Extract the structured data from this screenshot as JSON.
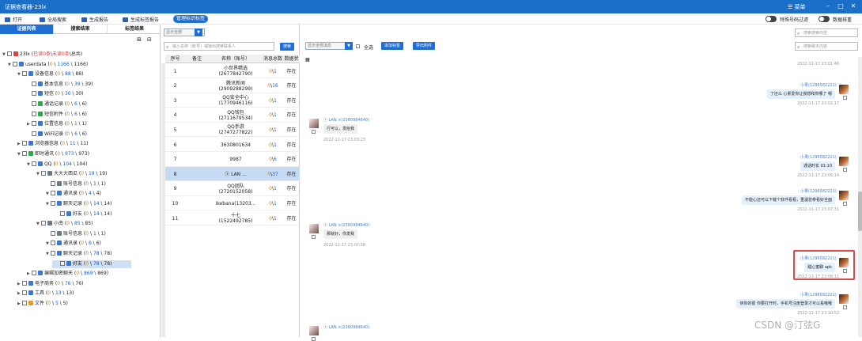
{
  "window": {
    "title": "证据查看器-23lx",
    "menu": "☰ 菜单"
  },
  "toolbar": {
    "open": "打开",
    "global_search": "全局搜索",
    "gen_report": "生成报告",
    "gen_tag_report": "生成标签报告",
    "manage_tags": "管理标识标签",
    "special_filter": "特殊号码过滤",
    "data_sum": "数据排重"
  },
  "left_tabs": [
    "证据列表",
    "搜索结果",
    "标签结果"
  ],
  "tree": [
    {
      "label": "23lx",
      "parts": [
        " (",
        "已读0条",
        "\\",
        "未读0条",
        "\\",
        "总共)"
      ],
      "icon": "red"
    },
    {
      "label": "userdata",
      "c1": "0",
      "c2": "1166",
      "c3": "1166",
      "icon": "blue"
    },
    {
      "label": "设备信息",
      "c1": "0",
      "c2": "88",
      "c3": "88",
      "icon": "blue"
    },
    {
      "label": "基本信息",
      "c1": "0",
      "c2": "39",
      "c3": "39",
      "icon": "blue"
    },
    {
      "label": "短信",
      "c1": "0",
      "c2": "30",
      "c3": "30",
      "icon": "blue"
    },
    {
      "label": "通话记录",
      "c1": "0",
      "c2": "6",
      "c3": "6",
      "icon": "green"
    },
    {
      "label": "短信附件",
      "c1": "0",
      "c2": "6",
      "c3": "6",
      "icon": "green"
    },
    {
      "label": "位置信息",
      "c1": "0",
      "c2": "1",
      "c3": "1",
      "icon": "blue"
    },
    {
      "label": "WiFi记录",
      "c1": "0",
      "c2": "6",
      "c3": "6",
      "icon": "blue"
    },
    {
      "label": "浏览器信息",
      "c1": "0",
      "c2": "11",
      "c3": "11",
      "icon": "blue"
    },
    {
      "label": "即时通讯",
      "c1": "0",
      "c2": "973",
      "c3": "973",
      "icon": "green"
    },
    {
      "label": "QQ",
      "c1": "0",
      "c2": "104",
      "c3": "104",
      "icon": "blue"
    },
    {
      "label": "大大大西瓜",
      "c1": "0",
      "c2": "19",
      "c3": "19",
      "icon": "gray"
    },
    {
      "label": "账号信息",
      "c1": "0",
      "c2": "1",
      "c3": "1",
      "icon": "gray"
    },
    {
      "label": "通讯录",
      "c1": "0",
      "c2": "4",
      "c3": "4",
      "icon": "blue"
    },
    {
      "label": "聊天记录",
      "c1": "0",
      "c2": "14",
      "c3": "14",
      "icon": "blue"
    },
    {
      "label": "好友",
      "c1": "0",
      "c2": "14",
      "c3": "14",
      "icon": "blue"
    },
    {
      "label": "小南",
      "c1": "0",
      "c2": "85",
      "c3": "85",
      "icon": "gray"
    },
    {
      "label": "账号信息",
      "c1": "0",
      "c2": "1",
      "c3": "1",
      "icon": "gray"
    },
    {
      "label": "通讯录",
      "c1": "0",
      "c2": "6",
      "c3": "6",
      "icon": "blue"
    },
    {
      "label": "聊天记录",
      "c1": "0",
      "c2": "78",
      "c3": "78",
      "icon": "blue"
    },
    {
      "label": "好友",
      "c1": "0",
      "c2": "78",
      "c3": "78",
      "icon": "blue"
    },
    {
      "label": "编辑加密聊天",
      "c1": "0",
      "c2": "869",
      "c3": "869",
      "icon": "blue"
    },
    {
      "label": "电子商务",
      "c1": "0",
      "c2": "76",
      "c3": "76",
      "icon": "blue"
    },
    {
      "label": "工具",
      "c1": "0",
      "c2": "13",
      "c3": "13",
      "icon": "blue"
    },
    {
      "label": "文件",
      "c1": "0",
      "c2": "5",
      "c3": "5",
      "icon": "orange"
    }
  ],
  "mid": {
    "select_all": "显示全部",
    "search_placeholder": "输入名称（账号）或输出搜索联系人",
    "search_btn": "搜索",
    "cols": [
      "序号",
      "备注",
      "名称（账号）",
      "消息总数",
      "数据状态"
    ],
    "rows": [
      {
        "n": "1",
        "name": "小世界精选",
        "acct": "(2677842790)",
        "a": "0",
        "b": "1",
        "s": "存在"
      },
      {
        "n": "2",
        "name": "腾讯新闻",
        "acct": "(2909288299)",
        "a": "0",
        "b": "16",
        "s": "存在"
      },
      {
        "n": "3",
        "name": "QQ安全中心",
        "acct": "(1770946116)",
        "a": "0",
        "b": "1",
        "s": "存在"
      },
      {
        "n": "4",
        "name": "QQ钱包",
        "acct": "(2711679534)",
        "a": "0",
        "b": "1",
        "s": "存在"
      },
      {
        "n": "5",
        "name": "QQ手游",
        "acct": "(2747277822)",
        "a": "0",
        "b": "1",
        "s": "存在"
      },
      {
        "n": "6",
        "name": "3630801634",
        "acct": "",
        "a": "0",
        "b": "1",
        "s": "存在"
      },
      {
        "n": "7",
        "name": "9987",
        "acct": "",
        "a": "0",
        "b": "6",
        "s": "存在"
      },
      {
        "n": "8",
        "name": "ⓩ LAN ...",
        "acct": "",
        "a": "0",
        "b": "37",
        "s": "存在"
      },
      {
        "n": "9",
        "name": "QQ团队",
        "acct": "(2720152058)",
        "a": "0",
        "b": "1",
        "s": "存在"
      },
      {
        "n": "10",
        "name": "Ikebana(13203...",
        "acct": "",
        "a": "0",
        "b": "1",
        "s": "存在"
      },
      {
        "n": "11",
        "name": "十七",
        "acct": "(1522492785)",
        "a": "0",
        "b": "1",
        "s": "存在"
      }
    ]
  },
  "right": {
    "filter": "显示全部消息",
    "select": "全选",
    "add_tag": "添加标签",
    "export": "导出附件",
    "search_ph": "搜索聊天内容",
    "top_search_ph": "搜索搜索内容",
    "messages": [
      {
        "side": "r",
        "hdr": "",
        "text": "",
        "time": "2022-11-17 23:01:46"
      },
      {
        "side": "r",
        "hdr": "小果(1296582221)",
        "text": "了还么 心累爱你让我想和你哪了 嗯",
        "time": "2022-11-17 23:02:17"
      },
      {
        "side": "l",
        "hdr": "ⓩ LAN ×(2360984640)",
        "text": "行可以，发给我",
        "time": "2022-11-17 23:03:23"
      },
      {
        "side": "r",
        "hdr": "小果(1296582221)",
        "text": "通话时长 01:10",
        "time": "2022-11-17 23:06:14"
      },
      {
        "side": "r",
        "hdr": "小果(1296582221)",
        "text": "不能心还可以下载个软件看看，重温曾参看好全面",
        "time": "2022-11-17 23:07:31"
      },
      {
        "side": "l",
        "hdr": "ⓩ LAN ×(2360984640)",
        "text": "那就好，你发我",
        "time": "2022-11-17 23:07:58"
      },
      {
        "side": "r",
        "hdr": "小果(1296582221)",
        "text": "甜心蜜聊 apk",
        "time": "2022-11-17 23:08:11"
      },
      {
        "side": "r",
        "hdr": "小果(1296582221)",
        "text": "侠你的很 你要打开时，手机号注册登录才可以看哦哦",
        "time": "2022-11-17 23:10:52"
      },
      {
        "side": "l",
        "hdr": "ⓩ LAN ×(2360984640)",
        "text": "",
        "time": ""
      }
    ]
  },
  "watermark": "CSDN @汀弦G"
}
